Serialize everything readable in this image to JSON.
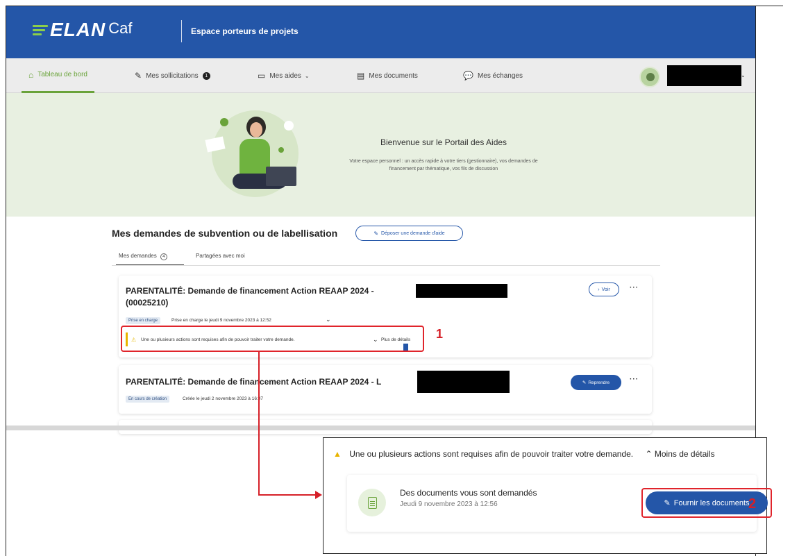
{
  "header": {
    "logo_elan": "ELAN",
    "logo_caf": "Caf",
    "title": "Espace porteurs de projets"
  },
  "nav": {
    "items": [
      {
        "label": "Tableau de bord",
        "icon": "home-icon"
      },
      {
        "label": "Mes sollicitations",
        "icon": "pen-icon",
        "badge": "1"
      },
      {
        "label": "Mes aides",
        "icon": "folder-icon"
      },
      {
        "label": "Mes documents",
        "icon": "document-icon"
      },
      {
        "label": "Mes échanges",
        "icon": "chat-icon"
      }
    ]
  },
  "hero": {
    "title": "Bienvenue sur le Portail des Aides",
    "subtitle": "Votre espace personnel : un accès rapide à votre tiers (gestionnaire), vos demandes de financement par thématique, vos fils de discussion"
  },
  "section": {
    "title": "Mes demandes de subvention ou de labellisation",
    "deposit_button": "Déposer une demande d'aide",
    "tabs": [
      {
        "label": "Mes demandes",
        "count": "4"
      },
      {
        "label": "Partagées avec moi"
      }
    ]
  },
  "cards": [
    {
      "title": "PARENTALITÉ: Demande de financement Action REAAP 2024 -",
      "reference": "(00025210)",
      "status": "Prise en charge",
      "status_text": "Prise en charge le jeudi 9 novembre 2023 à 12:52",
      "action_label": "Voir",
      "warning": "Une ou plusieurs actions sont requises afin de pouvoir traiter votre demande.",
      "details_label": "Plus de détails"
    },
    {
      "title": "PARENTALITÉ: Demande de financement Action REAAP 2024 - L",
      "status": "En cours de création",
      "status_text": "Créée le jeudi 2 novembre 2023 à 16:07",
      "action_label": "Reprendre"
    }
  ],
  "annotations": {
    "marker_1": "1",
    "marker_2": "2"
  },
  "zoom": {
    "warning": "Une ou plusieurs actions sont requises afin de pouvoir traiter votre demande.",
    "less_details": "Moins de détails",
    "doc_title": "Des documents vous sont demandés",
    "doc_date": "Jeudi 9 novembre 2023 à 12:56",
    "button": "Fournir les documents"
  },
  "colors": {
    "brand_blue": "#2456a8",
    "accent_green": "#6aa33a",
    "hero_bg": "#e8f0e1",
    "annotation_red": "#e0242b"
  }
}
